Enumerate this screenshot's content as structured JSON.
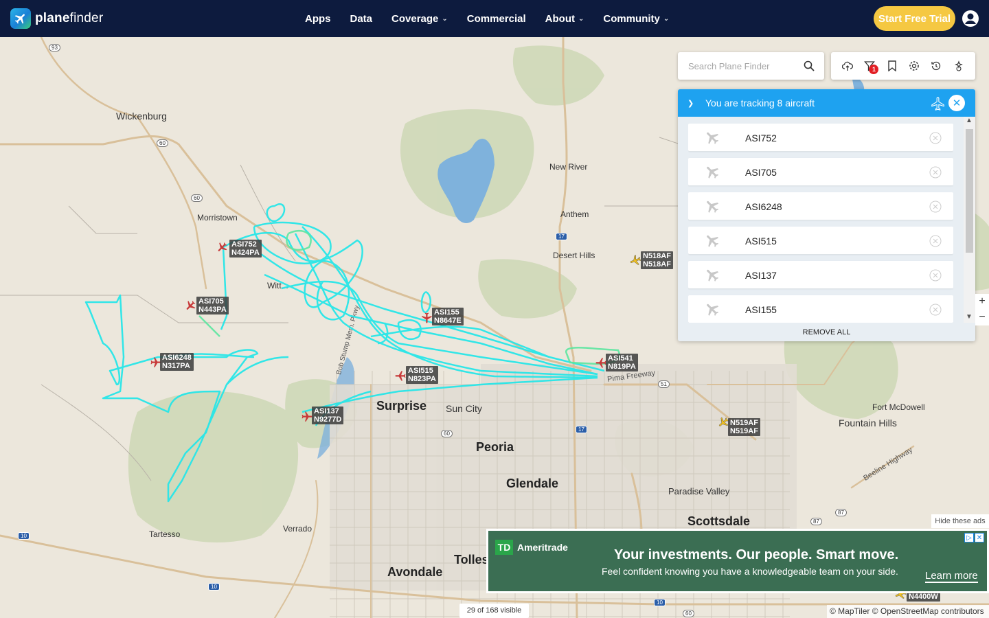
{
  "nav": {
    "logo_part1": "plane",
    "logo_part2": "finder",
    "items": [
      {
        "label": "Apps",
        "dropdown": false
      },
      {
        "label": "Data",
        "dropdown": false
      },
      {
        "label": "Coverage",
        "dropdown": true
      },
      {
        "label": "Commercial",
        "dropdown": false
      },
      {
        "label": "About",
        "dropdown": true
      },
      {
        "label": "Community",
        "dropdown": true
      }
    ],
    "cta": "Start Free Trial"
  },
  "search": {
    "placeholder": "Search Plane Finder"
  },
  "toolbar": {
    "icons": [
      "cloud-upload-icon",
      "filter-icon",
      "bookmark-icon",
      "settings-gear-icon",
      "history-icon",
      "3d-view-icon"
    ],
    "filter_badge": "1"
  },
  "tracking": {
    "title": "You are tracking 8 aircraft",
    "aircraft": [
      "ASI752",
      "ASI705",
      "ASI6248",
      "ASI515",
      "ASI137",
      "ASI155"
    ],
    "remove_all": "REMOVE ALL"
  },
  "zoom": {
    "in": "+",
    "out": "−"
  },
  "map": {
    "places": {
      "wickenburg": "Wickenburg",
      "morristown": "Morristown",
      "wittmann": "Witt...",
      "new_river": "New River",
      "anthem": "Anthem",
      "desert_hills": "Desert Hills",
      "surprise": "Surprise",
      "sun_city": "Sun City",
      "peoria": "Peoria",
      "glendale": "Glendale",
      "fort_mcdowell": "Fort McDowell",
      "fountain_hills": "Fountain Hills",
      "paradise_valley": "Paradise Valley",
      "scottsdale": "Scottsdale",
      "tartesso": "Tartesso",
      "verrado": "Verrado",
      "avondale": "Avondale",
      "tolleson": "Tolles",
      "beeline": "Beeline Highway",
      "loop101": "Pima Freeway",
      "bob_stump": "Bob Stump Mem. Pkwy"
    },
    "shields": [
      "93",
      "60",
      "60",
      "17",
      "51",
      "17",
      "60",
      "87",
      "87",
      "10",
      "10",
      "10",
      "60"
    ],
    "aircraft_labels": [
      {
        "callsign": "ASI752",
        "reg": "N424PA"
      },
      {
        "callsign": "ASI705",
        "reg": "N443PA"
      },
      {
        "callsign": "ASI6248",
        "reg": "N317PA"
      },
      {
        "callsign": "ASI515",
        "reg": "N823PA"
      },
      {
        "callsign": "ASI137",
        "reg": "N9277D"
      },
      {
        "callsign": "ASI155",
        "reg": "N8647E"
      },
      {
        "callsign": "ASI541",
        "reg": "N819PA"
      },
      {
        "callsign": "N518AF",
        "reg": "N518AF"
      },
      {
        "callsign": "N519AF",
        "reg": "N519AF"
      },
      {
        "callsign": "N4400W",
        "reg": ""
      }
    ],
    "tracked_color": "#27e6e8",
    "visible_count": "29 of 168 visible",
    "attribution": "© MapTiler © OpenStreetMap contributors"
  },
  "ad": {
    "hide": "Hide these ads",
    "brand_mark": "TD",
    "brand": "Ameritrade",
    "headline": "Your investments. Our people. Smart move.",
    "sub": "Feel confident knowing you have a knowledgeable team on your side.",
    "cta": "Learn more"
  }
}
